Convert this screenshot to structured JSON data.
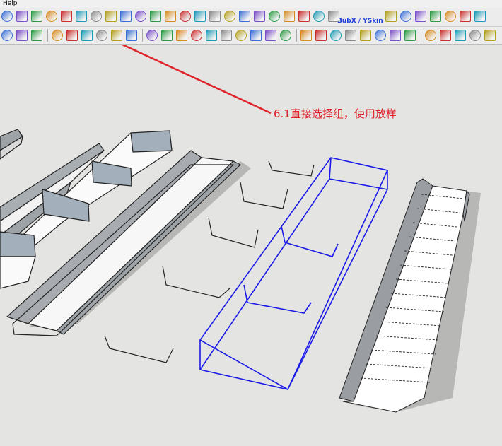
{
  "menubar": {
    "help": "Help"
  },
  "toolbar": {
    "plugin_label": "BubX / YSkin",
    "row1_icons": [
      "paint-bucket-icon",
      "cube-purple-icon",
      "wireframe-icon",
      "magnet-icon",
      "bucket-mesh-icon",
      "curve-icon",
      "polyline-icon",
      "line-icon",
      "bezier-icon",
      "spiral-icon",
      "arc-icon",
      "grid-surface-icon",
      "loft-icon",
      "extrude-icon",
      "shell-icon",
      "cube-green-icon",
      "arch-icon",
      "fold-icon",
      "terrain-icon",
      "rainbow-icon",
      "bubble-icon",
      "skin-icon",
      "cylinder-icon",
      "map-icon",
      "push-pull-icon",
      "tag-icon",
      "sort-icon",
      "rotate-icon",
      "rotate-right-icon",
      "tool-icon"
    ],
    "row2_icons": [
      "layer-icon",
      "folder-icon",
      "camera-icon",
      "paint-icon",
      "cross-icon",
      "leaf-icon",
      "text-icon",
      "dimension-icon",
      "caliper-icon",
      "orbit-icon",
      "pan-icon",
      "zoom-icon",
      "zoom-window-icon",
      "zoom-extents-icon",
      "search-icon",
      "position-camera-icon",
      "eye-icon",
      "footprint-icon",
      "section-icon",
      "front-view-icon",
      "iso-view-icon",
      "left-view-icon",
      "top-view-icon",
      "xray-icon",
      "back-edges-icon",
      "wireframe-style-icon",
      "hidden-line-icon",
      "axes-icon",
      "shadow-icon",
      "fog-icon",
      "house-icon",
      "component-icon"
    ]
  },
  "annotation": {
    "text": "6.1直接选择组，使用放样",
    "color": "#e0232a"
  },
  "colors": {
    "selection_blue": "#1a1ae6",
    "viewport_bg": "#e4e4e2",
    "face_gray": "#a8acb0",
    "shadow_gray": "#b3b3b1"
  }
}
